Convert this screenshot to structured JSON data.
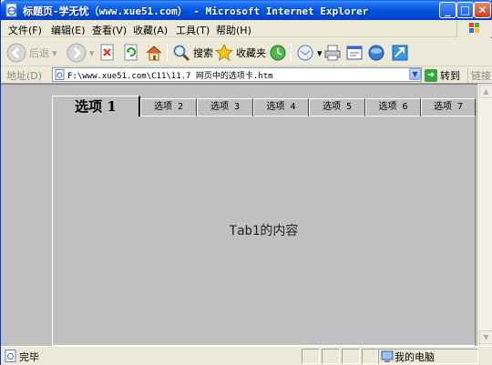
{
  "window": {
    "title": "标题页-学无忧（www.xue51.com） - Microsoft Internet Explorer",
    "minimize": "_",
    "maximize": "□",
    "close": "✕"
  },
  "menu": [
    "文件(F)",
    "编辑(E)",
    "查看(V)",
    "收藏(A)",
    "工具(T)",
    "帮助(H)"
  ],
  "toolbar": {
    "back_label": "后退",
    "search_label": "搜索",
    "favorites_label": "收藏夹"
  },
  "address": {
    "label": "地址(D)",
    "value": "F:\\www.xue51.com\\C11\\11.7  网页中的选项卡.htm",
    "go_label": "转到",
    "links_label": "链接"
  },
  "tabs": [
    "选项 1",
    "选项 2",
    "选项 3",
    "选项 4",
    "选项 5",
    "选项 6",
    "选项 7"
  ],
  "active_tab": 0,
  "tab_content": "Tab1的内容",
  "status": {
    "text": "完毕",
    "zone": "我的电脑"
  },
  "icons": [
    "ie-page-icon",
    "windows-logo-icon",
    "back-icon",
    "forward-icon",
    "stop-icon",
    "refresh-icon",
    "home-icon",
    "search-icon",
    "favorites-star-icon",
    "history-icon",
    "mail-icon",
    "print-icon",
    "edit-icon",
    "messenger-icon",
    "link-icon",
    "go-arrow-icon",
    "computer-icon"
  ]
}
